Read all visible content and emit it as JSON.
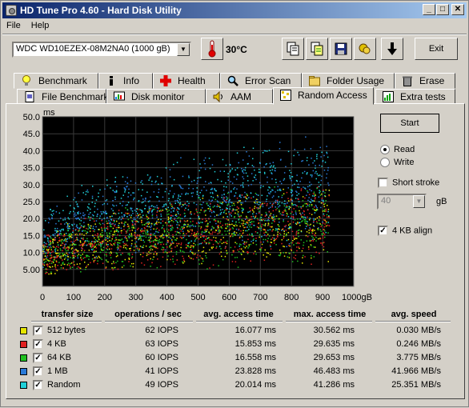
{
  "window": {
    "title": "HD Tune Pro 4.60 - Hard Disk Utility"
  },
  "menu": [
    {
      "label": "File",
      "accel": "F"
    },
    {
      "label": "Help",
      "accel": "H"
    }
  ],
  "toolbar": {
    "drive": "WDC    WD10EZEX-08M2NA0 (1000 gB)",
    "temperature": "30°C",
    "exit_label": "Exit",
    "icons": [
      "thermometer-icon",
      "copy-icon",
      "copy-all-icon",
      "save-icon",
      "screenshot-icon",
      "download-arrow-icon"
    ]
  },
  "tabs_top": [
    {
      "label": "Benchmark",
      "icon": "lightbulb-icon"
    },
    {
      "label": "Info",
      "icon": "info-icon"
    },
    {
      "label": "Health",
      "icon": "health-cross-icon"
    },
    {
      "label": "Error Scan",
      "icon": "magnifier-icon"
    },
    {
      "label": "Folder Usage",
      "icon": "folder-icon"
    },
    {
      "label": "Erase",
      "icon": "trash-icon"
    }
  ],
  "tabs_bottom": [
    {
      "label": "File Benchmark",
      "icon": "file-icon"
    },
    {
      "label": "Disk monitor",
      "icon": "monitor-icon"
    },
    {
      "label": "AAM",
      "icon": "speaker-icon"
    },
    {
      "label": "Random Access",
      "icon": "random-icon",
      "active": true
    },
    {
      "label": "Extra tests",
      "icon": "tests-icon"
    }
  ],
  "controls": {
    "start_label": "Start",
    "read_label": "Read",
    "write_label": "Write",
    "short_stroke_label": "Short stroke",
    "short_stroke_value": "40",
    "gb_label": "gB",
    "align_label": "4 KB align",
    "mode": "Read",
    "short_stroke_checked": false,
    "align_checked": true
  },
  "chart_data": {
    "type": "scatter",
    "ylabel": "ms",
    "xlabel": "",
    "ylim": [
      0,
      50
    ],
    "xlim": [
      0,
      1000
    ],
    "yticks": [
      "50.0",
      "45.0",
      "40.0",
      "35.0",
      "30.0",
      "25.0",
      "20.0",
      "15.0",
      "10.0",
      "5.00"
    ],
    "xticks": [
      "0",
      "100",
      "200",
      "300",
      "400",
      "500",
      "600",
      "700",
      "800",
      "900",
      "1000gB"
    ],
    "grid": true,
    "background": "#000000",
    "series": [
      {
        "name": "512 bytes",
        "color": "#e6e600",
        "avg": 16.077,
        "max": 30.562
      },
      {
        "name": "4 KB",
        "color": "#e02020",
        "avg": 15.853,
        "max": 29.635
      },
      {
        "name": "64 KB",
        "color": "#20c020",
        "avg": 16.558,
        "max": 29.653
      },
      {
        "name": "1 MB",
        "color": "#2a7ad8",
        "avg": 23.828,
        "max": 46.483
      },
      {
        "name": "Random",
        "color": "#20d0d8",
        "avg": 20.014,
        "max": 41.286
      }
    ]
  },
  "table": {
    "headers": [
      "transfer size",
      "operations / sec",
      "avg. access time",
      "max. access time",
      "avg. speed"
    ],
    "rows": [
      {
        "label": "512 bytes",
        "color": "#e6e600",
        "ops": "62 IOPS",
        "avg": "16.077 ms",
        "max": "30.562 ms",
        "speed": "0.030 MB/s"
      },
      {
        "label": "4 KB",
        "color": "#e02020",
        "ops": "63 IOPS",
        "avg": "15.853 ms",
        "max": "29.635 ms",
        "speed": "0.246 MB/s"
      },
      {
        "label": "64 KB",
        "color": "#20c020",
        "ops": "60 IOPS",
        "avg": "16.558 ms",
        "max": "29.653 ms",
        "speed": "3.775 MB/s"
      },
      {
        "label": "1 MB",
        "color": "#2a7ad8",
        "ops": "41 IOPS",
        "avg": "23.828 ms",
        "max": "46.483 ms",
        "speed": "41.966 MB/s"
      },
      {
        "label": "Random",
        "color": "#20d0d8",
        "ops": "49 IOPS",
        "avg": "20.014 ms",
        "max": "41.286 ms",
        "speed": "25.351 MB/s"
      }
    ]
  }
}
